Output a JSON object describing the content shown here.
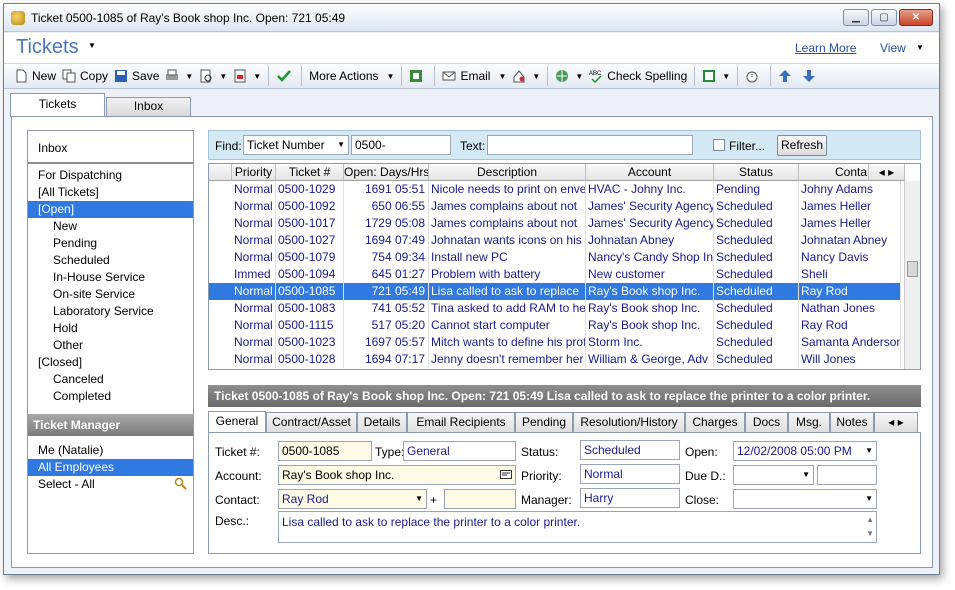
{
  "window": {
    "title": "Ticket  0500-1085 of Ray's Book shop Inc. Open:   721 05:49",
    "minimize": "▁",
    "maximize": "▢",
    "close": "✕"
  },
  "header": {
    "app_title": "Tickets",
    "learn_more": "Learn More",
    "view": "View"
  },
  "toolbar": {
    "new": "New",
    "copy": "Copy",
    "save": "Save",
    "more_actions": "More Actions",
    "email": "Email",
    "check_spelling": "Check Spelling"
  },
  "tabs": {
    "tickets": "Tickets",
    "inbox": "Inbox"
  },
  "sidebar": {
    "items": [
      {
        "label": "Inbox",
        "sub": false,
        "sel": false
      },
      {
        "label": "For Dispatching",
        "sub": false,
        "sel": false
      },
      {
        "label": "[All Tickets]",
        "sub": false,
        "sel": false
      },
      {
        "label": "[Open]",
        "sub": false,
        "sel": true
      },
      {
        "label": "New",
        "sub": true,
        "sel": false
      },
      {
        "label": "Pending",
        "sub": true,
        "sel": false
      },
      {
        "label": "Scheduled",
        "sub": true,
        "sel": false
      },
      {
        "label": "In-House Service",
        "sub": true,
        "sel": false
      },
      {
        "label": "On-site Service",
        "sub": true,
        "sel": false
      },
      {
        "label": "Laboratory Service",
        "sub": true,
        "sel": false
      },
      {
        "label": "Hold",
        "sub": true,
        "sel": false
      },
      {
        "label": "Other",
        "sub": true,
        "sel": false
      },
      {
        "label": "[Closed]",
        "sub": false,
        "sel": false
      },
      {
        "label": "Canceled",
        "sub": true,
        "sel": false
      },
      {
        "label": "Completed",
        "sub": true,
        "sel": false
      }
    ],
    "manager_title": "Ticket Manager",
    "manager_items": [
      {
        "label": "Me (Natalie)",
        "sel": false
      },
      {
        "label": "All Employees",
        "sel": true
      },
      {
        "label": "Select - All",
        "sel": false
      }
    ]
  },
  "search": {
    "find_label": "Find:",
    "find_field": "Ticket Number",
    "find_value": "0500-",
    "text_label": "Text:",
    "text_value": "",
    "filter_label": "Filter...",
    "refresh": "Refresh"
  },
  "grid": {
    "columns": [
      "Priority",
      "Ticket #",
      "Open: Days/Hrs",
      "Description",
      "Account",
      "Status",
      "Conta"
    ],
    "rows": [
      [
        "Normal",
        "0500-1029",
        "1691 05:51",
        "Nicole needs to print on envelopes",
        "HVAC - Johny Inc.",
        "Pending",
        "Johny Adams"
      ],
      [
        "Normal",
        "0500-1092",
        "650 06:55",
        "James complains about not",
        "James' Security Agency",
        "Scheduled",
        "James Heller"
      ],
      [
        "Normal",
        "0500-1017",
        "1729 05:08",
        "James complains about not",
        "James' Security Agency",
        "Scheduled",
        "James Heller"
      ],
      [
        "Normal",
        "0500-1027",
        "1694 07:49",
        "Johnatan wants icons on his",
        "Johnatan Abney",
        "Scheduled",
        "Johnatan Abney"
      ],
      [
        "Normal",
        "0500-1079",
        "754 09:34",
        "Install new PC",
        "Nancy's Candy Shop Inc.",
        "Scheduled",
        "Nancy Davis"
      ],
      [
        "Immed",
        "0500-1094",
        "645 01:27",
        "Problem with battery",
        "New customer",
        "Scheduled",
        "Sheli"
      ],
      [
        "Normal",
        "0500-1085",
        "721 05:49",
        "Lisa called to ask to replace",
        "Ray's Book shop Inc.",
        "Scheduled",
        "Ray Rod"
      ],
      [
        "Normal",
        "0500-1083",
        "741 05:52",
        "Tina asked to add RAM to her",
        "Ray's Book shop Inc.",
        "Scheduled",
        "Nathan Jones"
      ],
      [
        "Normal",
        "0500-1115",
        "517 05:20",
        "Cannot start computer",
        "Ray's Book shop Inc.",
        "Scheduled",
        "Ray Rod"
      ],
      [
        "Normal",
        "0500-1023",
        "1697 05:57",
        "Mitch wants to define his profile",
        "Storm Inc.",
        "Scheduled",
        "Samanta Anderson"
      ],
      [
        "Normal",
        "0500-1028",
        "1694 07:17",
        "Jenny doesn't remember her",
        "William & George, Adv",
        "Scheduled",
        "Will Jones"
      ]
    ],
    "selected_row": 6
  },
  "summary": "Ticket  0500-1085 of Ray's Book shop Inc. Open:   721 05:49 Lisa called to ask to replace the printer to a color printer.",
  "detail_tabs": [
    "General",
    "Contract/Asset",
    "Details",
    "Email Recipients",
    "Pending",
    "Resolution/History",
    "Charges",
    "Docs",
    "Msg.",
    "Notes"
  ],
  "detail": {
    "ticket_label": "Ticket #:",
    "ticket_value": "0500-1085",
    "type_label": "Type:",
    "type_value": "General",
    "status_label": "Status:",
    "status_value": "Scheduled",
    "open_label": "Open:",
    "open_value": "12/02/2008  05:00 PM",
    "account_label": "Account:",
    "account_value": "Ray's Book shop Inc.",
    "priority_label": "Priority:",
    "priority_value": "Normal",
    "due_label": "Due D.:",
    "due_value": "",
    "contact_label": "Contact:",
    "contact_value": "Ray Rod",
    "manager_label": "Manager:",
    "manager_value": "Harry",
    "close_label": "Close:",
    "close_value": "",
    "desc_label": "Desc.:",
    "desc_value": "Lisa called to ask to replace the printer to a color printer."
  }
}
